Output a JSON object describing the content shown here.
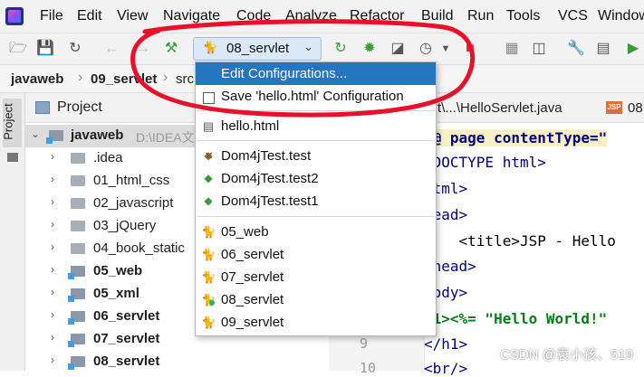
{
  "menu": [
    "File",
    "Edit",
    "View",
    "Navigate",
    "Code",
    "Analyze",
    "Refactor",
    "Build",
    "Run",
    "Tools",
    "VCS",
    "Window"
  ],
  "toolbar": {
    "run_config_label": "08_servlet",
    "accent_color": "#2675bf",
    "run_color": "#3a9b3a",
    "stop_color": "#d62b2b"
  },
  "breadcrumb": [
    "javaweb",
    "09_servlet",
    "src"
  ],
  "left_strip": {
    "project_label": "Project"
  },
  "project_panel": {
    "header_label": "Project",
    "root": {
      "name": "javaweb",
      "path": "D:\\IDEA文"
    },
    "items": [
      {
        "name": ".idea",
        "bold": false
      },
      {
        "name": "01_html_css",
        "bold": false
      },
      {
        "name": "02_javascript",
        "bold": false
      },
      {
        "name": "03_jQuery",
        "bold": false
      },
      {
        "name": "04_book_static",
        "bold": false
      },
      {
        "name": "05_web",
        "bold": true
      },
      {
        "name": "05_xml",
        "bold": true
      },
      {
        "name": "06_servlet",
        "bold": true
      },
      {
        "name": "07_servlet",
        "bold": true
      },
      {
        "name": "08_servlet",
        "bold": true
      }
    ]
  },
  "editor": {
    "tabs": [
      "t\\...\\HelloServlet.java",
      "08"
    ],
    "gutter_numbers": [
      "9",
      "10"
    ],
    "code_lines": [
      "%@ page contentType=\"",
      "!DOCTYPE html>",
      "html>",
      "head>",
      "    <title>JSP - Hello",
      "/head>",
      "body>",
      "h1><%= \"Hello World!\"",
      "</h1>",
      "<br/>"
    ]
  },
  "config_popup": {
    "edit_label": "Edit Configurations...",
    "save_label": "Save 'hello.html' Configuration",
    "html_item": "hello.html",
    "tests": [
      "Dom4jTest.test",
      "Dom4jTest.test2",
      "Dom4jTest.test1"
    ],
    "tomcat": [
      "05_web",
      "06_servlet",
      "07_servlet",
      "08_servlet",
      "09_servlet"
    ]
  },
  "watermark": "CSDN @袁小孩、519"
}
